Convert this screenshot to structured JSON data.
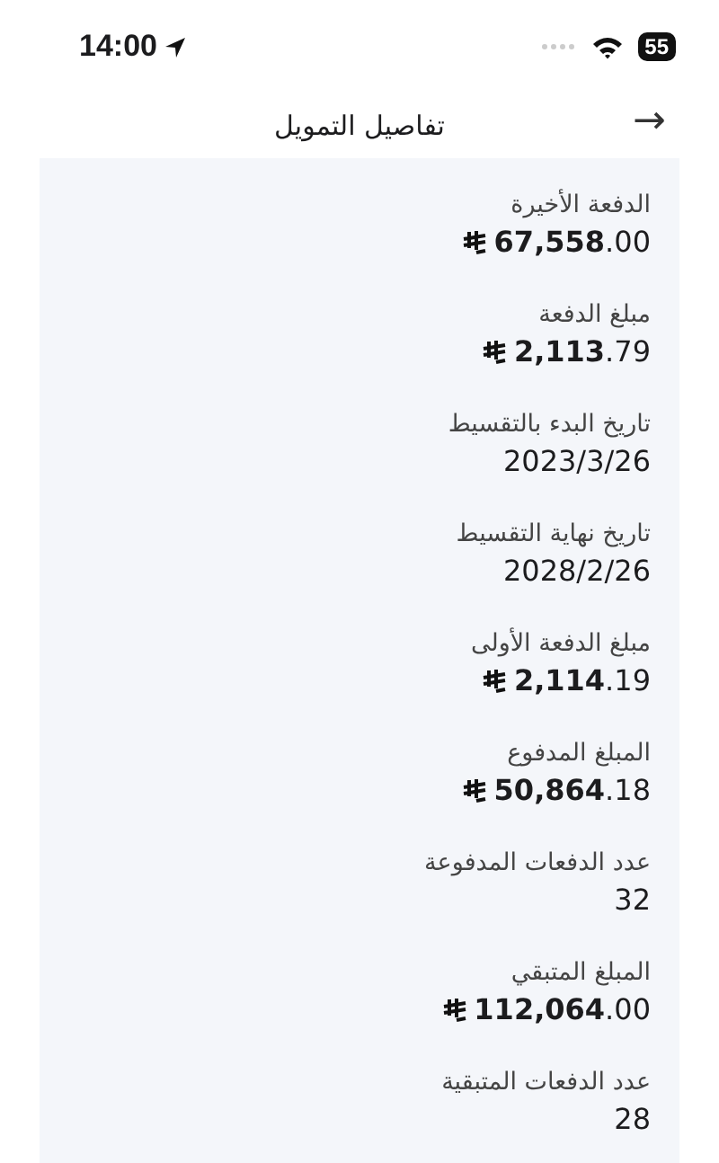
{
  "status_bar": {
    "time": "14:00",
    "battery": "55"
  },
  "header": {
    "title": "تفاصيل التمويل",
    "back": "→"
  },
  "details": [
    {
      "label": "الدفعة الأخيرة",
      "value": "**67,558**.00",
      "kind": "amount"
    },
    {
      "label": "مبلغ الدفعة",
      "value": "**2,113**.79",
      "kind": "amount"
    },
    {
      "label": "تاريخ البدء بالتقسيط",
      "value": "2023/3/26",
      "kind": "plain"
    },
    {
      "label": "تاريخ نهاية التقسيط",
      "value": "2028/2/26",
      "kind": "plain"
    },
    {
      "label": "مبلغ الدفعة الأولى",
      "value": "**2,114**.19",
      "kind": "amount"
    },
    {
      "label": "المبلغ المدفوع",
      "value": "**50,864**.18",
      "kind": "amount"
    },
    {
      "label": "عدد الدفعات المدفوعة",
      "value": "32",
      "kind": "plain"
    },
    {
      "label": "المبلغ المتبقي",
      "value": "**112,064**.00",
      "kind": "amount"
    },
    {
      "label": "عدد الدفعات المتبقية",
      "value": "28",
      "kind": "plain"
    }
  ]
}
